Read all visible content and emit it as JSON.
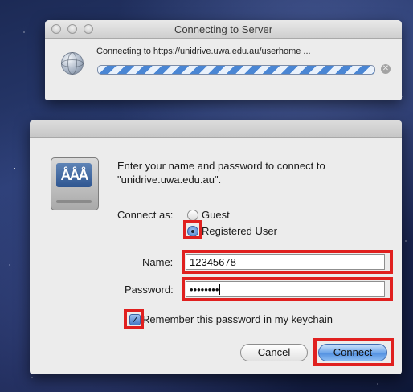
{
  "connecting_window": {
    "title": "Connecting to Server",
    "status_text": "Connecting to https://unidrive.uwa.edu.au/userhome ...",
    "progress": 1.0
  },
  "login_dialog": {
    "prompt": "Enter your name and password to connect to \"unidrive.uwa.edu.au\".",
    "connect_as_label": "Connect as:",
    "options": [
      "Guest",
      "Registered User"
    ],
    "selected_option": "Registered User",
    "name_label": "Name:",
    "name_value": "12345678",
    "password_label": "Password:",
    "password_value": "••••••••",
    "remember_label": "Remember this password in my keychain",
    "remember_checked": true,
    "cancel_label": "Cancel",
    "connect_label": "Connect"
  },
  "icons": {
    "globe": "globe-icon",
    "stop": "stop-icon",
    "server": "file-server-icon",
    "server_glyph": "ÅÅÅ"
  },
  "colors": {
    "highlight": "#e0201f",
    "accent": "#4f8ee0"
  }
}
